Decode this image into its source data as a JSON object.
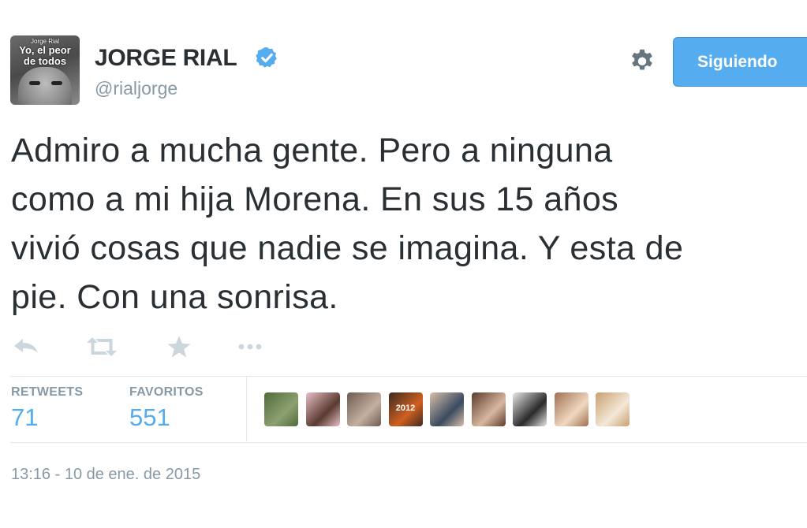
{
  "user": {
    "display_name": "JORGE RIAL",
    "handle": "@rialjorge",
    "avatar_caption_small": "Jorge Rial",
    "avatar_caption_big": "Yo, el peor de todos",
    "verified": true
  },
  "follow_button": {
    "label": "Siguiendo"
  },
  "settings": {
    "icon": "gear-icon"
  },
  "tweet": {
    "lines": [
      "Admiro a mucha gente. Pero a ninguna",
      "como a mi hija Morena. En sus 15 años",
      "vivió cosas que nadie se imagina. Y esta de",
      "pie. Con una sonrisa."
    ]
  },
  "actions": [
    "reply-icon",
    "retweet-icon",
    "favorite-icon",
    "more-icon"
  ],
  "stats": {
    "retweets_label": "RETWEETS",
    "retweets_count": "71",
    "favorites_label": "FAVORITOS",
    "favorites_count": "551"
  },
  "favoriters": [
    {
      "name": "favoriter-avatar-1",
      "colors": [
        "#4f6b3a",
        "#8da070"
      ]
    },
    {
      "name": "favoriter-avatar-2",
      "colors": [
        "#e8c0c8",
        "#5a3a30"
      ]
    },
    {
      "name": "favoriter-avatar-3",
      "colors": [
        "#6d5a50",
        "#c4b0a0"
      ]
    },
    {
      "name": "favoriter-avatar-4",
      "colors": [
        "#3a2a20",
        "#d06020"
      ],
      "text": "2012"
    },
    {
      "name": "favoriter-avatar-5",
      "colors": [
        "#d8c0a8",
        "#3a4a60"
      ]
    },
    {
      "name": "favoriter-avatar-6",
      "colors": [
        "#5a3a2a",
        "#d8b8a0"
      ]
    },
    {
      "name": "favoriter-avatar-7",
      "colors": [
        "#e8e8e8",
        "#2a2a2a"
      ]
    },
    {
      "name": "favoriter-avatar-8",
      "colors": [
        "#a07050",
        "#f0d8c0"
      ]
    },
    {
      "name": "favoriter-avatar-9",
      "colors": [
        "#c8a070",
        "#f4e8d8"
      ]
    }
  ],
  "timestamp": "13:16 - 10 de ene. de 2015",
  "colors": {
    "accent": "#55acee",
    "text": "#292f33",
    "muted": "#8899a6",
    "divider": "#e1e8ed"
  }
}
